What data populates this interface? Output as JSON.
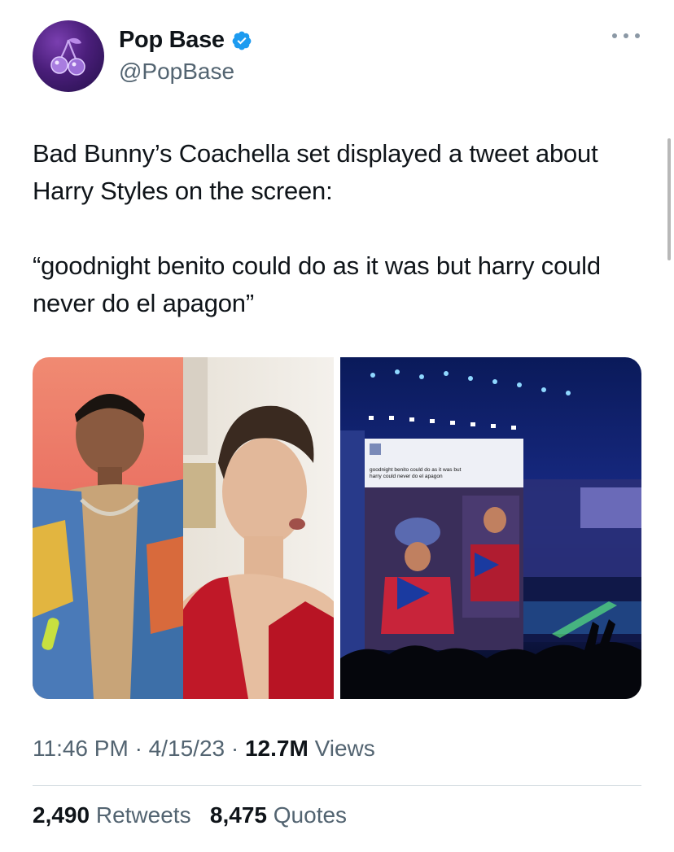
{
  "tweet": {
    "author": {
      "name": "Pop Base",
      "handle": "@PopBase",
      "verified": true,
      "avatar_icon": "cherry-icon"
    },
    "text_paragraphs": [
      "Bad Bunny’s Coachella set displayed a tweet about Harry Styles on the screen:",
      "“goodnight benito could do as it was but harry could never do el apagon”"
    ],
    "media": {
      "left_image": "bad-bunny-and-harry-styles-photo",
      "right_image": "coachella-stage-screen-photo",
      "screen_text": "goodnight benito could do as it was but harry could never do el apagon"
    },
    "time": "11:46 PM",
    "date": "4/15/23",
    "views_count": "12.7M",
    "views_label": "Views",
    "retweets_count": "2,490",
    "retweets_label": "Retweets",
    "quotes_count": "8,475",
    "quotes_label": "Quotes"
  },
  "colors": {
    "verified_blue": "#1d9bf0",
    "secondary_text": "#536471"
  }
}
